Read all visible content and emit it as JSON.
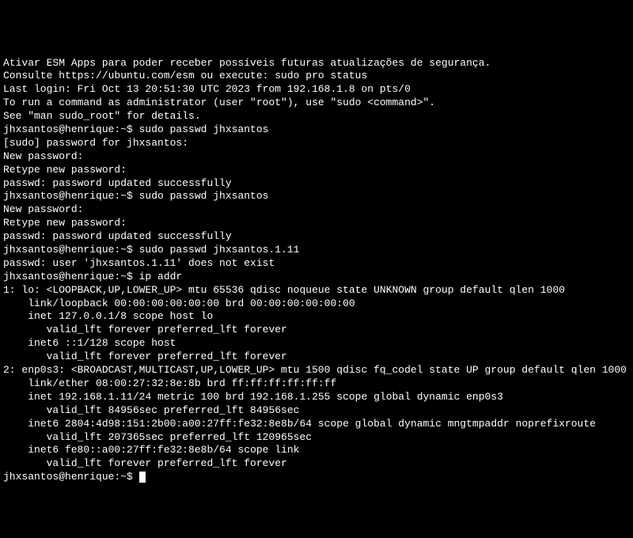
{
  "lines": [
    "Ativar ESM Apps para poder receber possíveis futuras atualizações de segurança.",
    "Consulte https://ubuntu.com/esm ou execute: sudo pro status",
    "",
    "",
    "Last login: Fri Oct 13 20:51:30 UTC 2023 from 192.168.1.8 on pts/0",
    "To run a command as administrator (user \"root\"), use \"sudo <command>\".",
    "See \"man sudo_root\" for details.",
    "",
    "jhxsantos@henrique:~$ sudo passwd jhxsantos",
    "[sudo] password for jhxsantos:",
    "New password:",
    "Retype new password:",
    "passwd: password updated successfully",
    "jhxsantos@henrique:~$ sudo passwd jhxsantos",
    "New password:",
    "Retype new password:",
    "passwd: password updated successfully",
    "jhxsantos@henrique:~$ sudo passwd jhxsantos.1.11",
    "passwd: user 'jhxsantos.1.11' does not exist",
    "jhxsantos@henrique:~$ ip addr",
    "1: lo: <LOOPBACK,UP,LOWER_UP> mtu 65536 qdisc noqueue state UNKNOWN group default qlen 1000",
    "    link/loopback 00:00:00:00:00:00 brd 00:00:00:00:00:00",
    "    inet 127.0.0.1/8 scope host lo",
    "       valid_lft forever preferred_lft forever",
    "    inet6 ::1/128 scope host",
    "       valid_lft forever preferred_lft forever",
    "2: enp0s3: <BROADCAST,MULTICAST,UP,LOWER_UP> mtu 1500 qdisc fq_codel state UP group default qlen 1000",
    "    link/ether 08:00:27:32:8e:8b brd ff:ff:ff:ff:ff:ff",
    "    inet 192.168.1.11/24 metric 100 brd 192.168.1.255 scope global dynamic enp0s3",
    "       valid_lft 84956sec preferred_lft 84956sec",
    "    inet6 2804:4d98:151:2b00:a00:27ff:fe32:8e8b/64 scope global dynamic mngtmpaddr noprefixroute",
    "       valid_lft 207365sec preferred_lft 120965sec",
    "    inet6 fe80::a00:27ff:fe32:8e8b/64 scope link",
    "       valid_lft forever preferred_lft forever"
  ],
  "prompt": "jhxsantos@henrique:~$ "
}
